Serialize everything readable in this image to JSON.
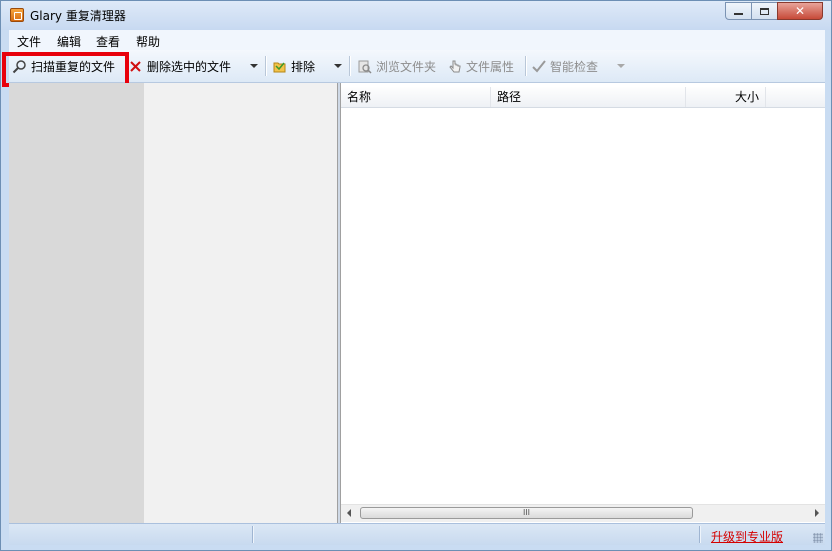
{
  "window": {
    "title": "Glary 重复清理器"
  },
  "menu": [
    {
      "label": "文件"
    },
    {
      "label": "编辑"
    },
    {
      "label": "查看"
    },
    {
      "label": "帮助"
    }
  ],
  "toolbar": {
    "scan": "扫描重复的文件",
    "delete": "删除选中的文件",
    "exclude": "排除",
    "browse": "浏览文件夹",
    "properties": "文件属性",
    "smart_check": "智能检查"
  },
  "columns": [
    {
      "label": "名称"
    },
    {
      "label": "路径"
    },
    {
      "label": "大小"
    }
  ],
  "scrollbar": {
    "thumb_glyph": "III"
  },
  "status": {
    "upgrade_link": "升级到专业版"
  },
  "colors": {
    "highlight": "#e8000b",
    "link": "#d40000"
  }
}
